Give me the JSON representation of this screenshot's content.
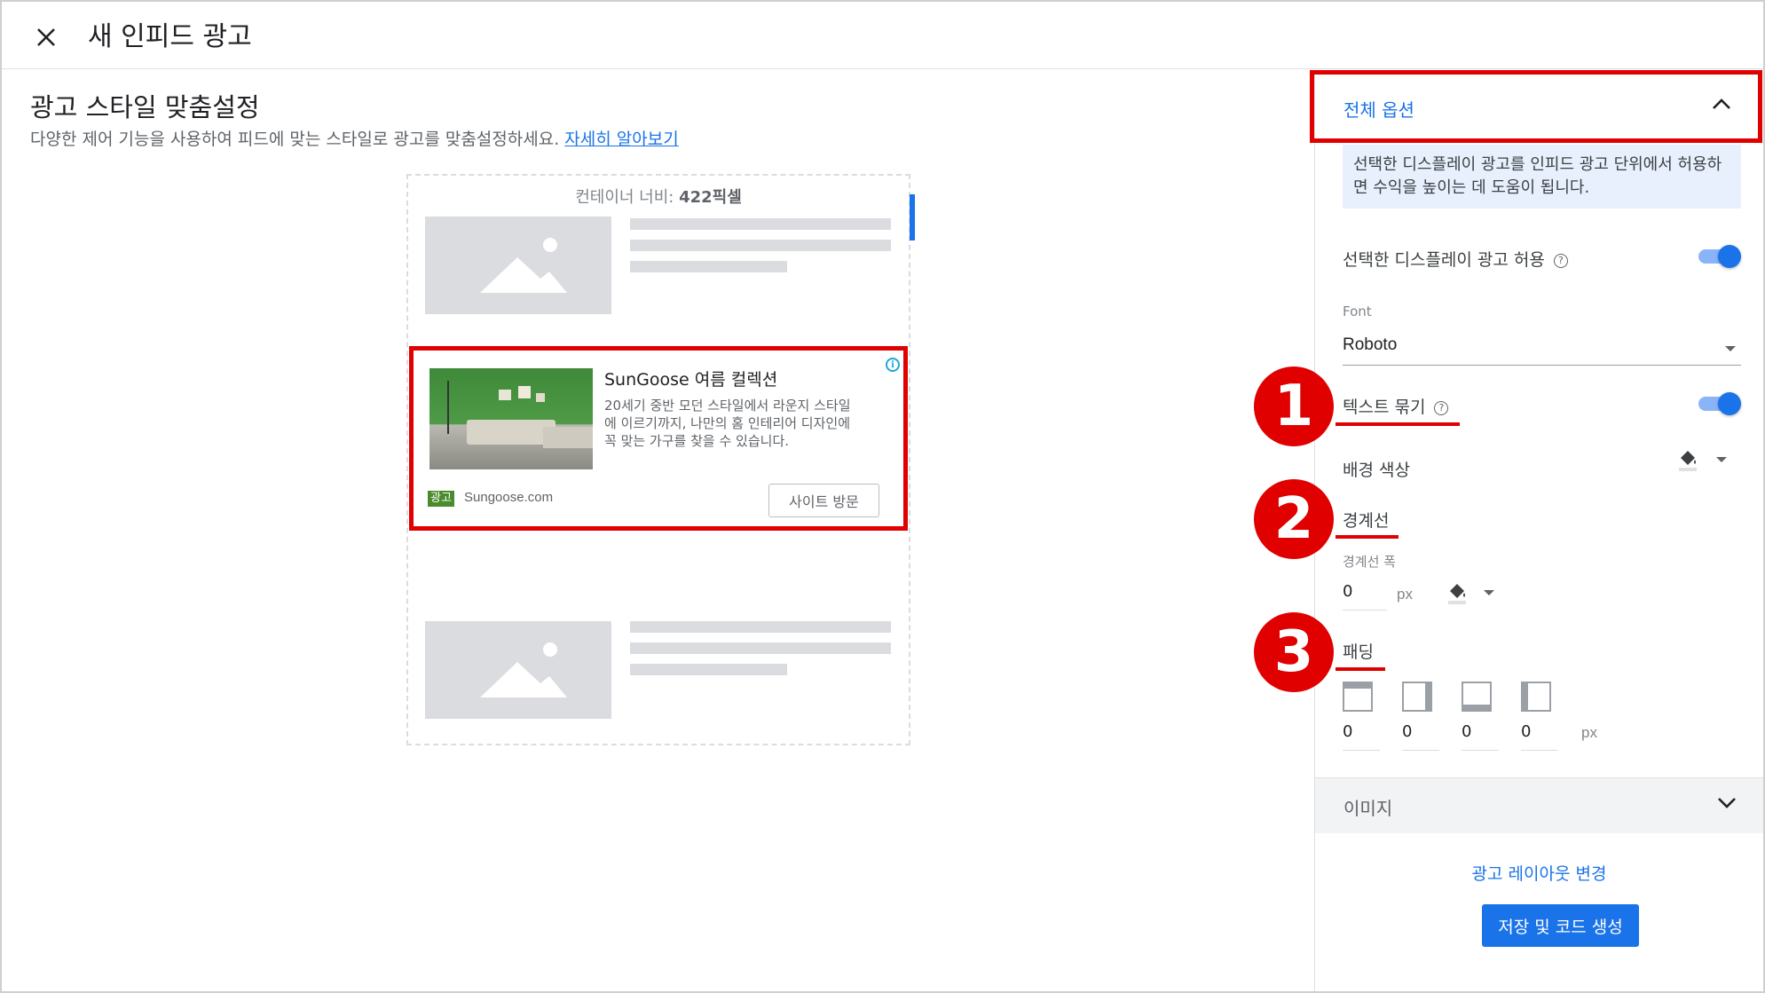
{
  "header": {
    "title": "새 인피드 광고"
  },
  "customize": {
    "title": "광고 스타일 맞춤설정",
    "description": "다양한 제어 기능을 사용하여 피드에 맞는 스타일로 광고를 맞춤설정하세요.",
    "learn_more": "자세히 알아보기"
  },
  "preview": {
    "container_label": "컨테이너 너비:",
    "container_width": "422픽셀"
  },
  "ad": {
    "headline": "SunGoose 여름 컬렉션",
    "body": "20세기 중반 모던 스타일에서 라운지 스타일에 이르기까지, 나만의 홈 인테리어 디자인에 꼭 맞는 가구를 찾을 수 있습니다.",
    "badge": "광고",
    "domain": "Sungoose.com",
    "cta": "사이트 방문"
  },
  "options": {
    "section_title": "전체 옵션",
    "info": "선택한 디스플레이 광고를 인피드 광고 단위에서 허용하면 수익을 높이는 데 도움이 됩니다.",
    "allow_display_label": "선택한 디스플레이 광고 허용",
    "allow_display_on": true,
    "font_label": "Font",
    "font_value": "Roboto",
    "text_wrap_label": "텍스트 묶기",
    "text_wrap_on": true,
    "bg_color_label": "배경 색상",
    "border_label": "경계선",
    "border_width_label": "경계선 폭",
    "border_width_value": "0",
    "border_unit": "px",
    "padding_label": "패딩",
    "padding_values": [
      "0",
      "0",
      "0",
      "0"
    ],
    "padding_unit": "px"
  },
  "annotations": [
    "1",
    "2",
    "3"
  ],
  "image_section": {
    "label": "이미지"
  },
  "actions": {
    "change_layout": "광고 레이아웃 변경",
    "save": "저장 및 코드 생성"
  },
  "colors": {
    "accent": "#1a73e8",
    "highlight": "#e00000",
    "ad_badge": "#4a8b2c"
  }
}
